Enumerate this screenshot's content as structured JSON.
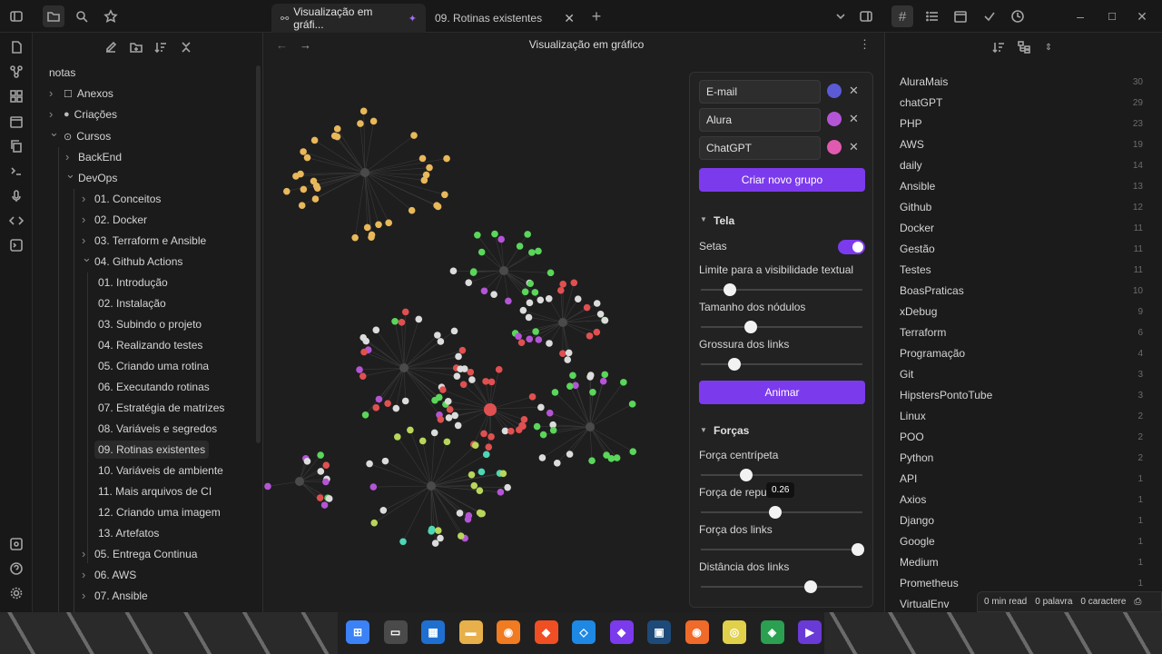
{
  "tabs": [
    {
      "label": "Visualização em gráfi..."
    },
    {
      "label": "09. Rotinas existentes"
    }
  ],
  "view_title": "Visualização em gráfico",
  "sidebar": {
    "root": "notas",
    "items": [
      {
        "label": "Anexos"
      },
      {
        "label": "Criações"
      },
      {
        "label": "Cursos"
      },
      {
        "label": "BackEnd"
      },
      {
        "label": "DevOps"
      },
      {
        "label": "01. Conceitos"
      },
      {
        "label": "02. Docker"
      },
      {
        "label": "03. Terraform e Ansible"
      },
      {
        "label": "04. Github Actions"
      },
      {
        "label": "01. Introdução"
      },
      {
        "label": "02. Instalação"
      },
      {
        "label": "03. Subindo o projeto"
      },
      {
        "label": "04. Realizando testes"
      },
      {
        "label": "05. Criando uma rotina"
      },
      {
        "label": "06. Executando rotinas"
      },
      {
        "label": "07. Estratégia de matrizes"
      },
      {
        "label": "08. Variáveis e segredos"
      },
      {
        "label": "09. Rotinas existentes"
      },
      {
        "label": "10. Variáveis de ambiente"
      },
      {
        "label": "11. Mais arquivos de CI"
      },
      {
        "label": "12. Criando uma imagem"
      },
      {
        "label": "13. Artefatos"
      },
      {
        "label": "05. Entrega Continua"
      },
      {
        "label": "06. AWS"
      },
      {
        "label": "07. Ansible"
      }
    ]
  },
  "graph_panel": {
    "groups": [
      {
        "query": "E-mail",
        "color": "#5b5bd6"
      },
      {
        "query": "Alura",
        "color": "#b455d6"
      },
      {
        "query": "ChatGPT",
        "color": "#e05ab0"
      }
    ],
    "new_group_label": "Criar novo grupo",
    "display_section": "Tela",
    "arrows_label": "Setas",
    "arrows_on": true,
    "text_fade_label": "Limite para a visibilidade textual",
    "text_fade_value": 0.18,
    "node_size_label": "Tamanho dos nódulos",
    "node_size_value": 0.31,
    "link_thickness_label": "Grossura dos links",
    "link_thickness_value": 0.21,
    "animate_label": "Animar",
    "forces_section": "Forças",
    "center_force_label": "Força centrípeta",
    "center_force_value": 0.28,
    "repel_force_label": "Força de repu",
    "repel_force_value": 0.46,
    "repel_tooltip": "0.26",
    "link_force_label": "Força dos links",
    "link_force_value": 0.97,
    "link_distance_label": "Distância dos links",
    "link_distance_value": 0.68
  },
  "tags": [
    {
      "name": "AluraMais",
      "count": "30"
    },
    {
      "name": "chatGPT",
      "count": "29"
    },
    {
      "name": "PHP",
      "count": "23"
    },
    {
      "name": "AWS",
      "count": "19"
    },
    {
      "name": "daily",
      "count": "14"
    },
    {
      "name": "Ansible",
      "count": "13"
    },
    {
      "name": "Github",
      "count": "12"
    },
    {
      "name": "Docker",
      "count": "11"
    },
    {
      "name": "Gestão",
      "count": "11"
    },
    {
      "name": "Testes",
      "count": "11"
    },
    {
      "name": "BoasPraticas",
      "count": "10"
    },
    {
      "name": "xDebug",
      "count": "9"
    },
    {
      "name": "Terraform",
      "count": "6"
    },
    {
      "name": "Programação",
      "count": "4"
    },
    {
      "name": "Git",
      "count": "3"
    },
    {
      "name": "HipstersPontoTube",
      "count": "3"
    },
    {
      "name": "Linux",
      "count": "2"
    },
    {
      "name": "POO",
      "count": "2"
    },
    {
      "name": "Python",
      "count": "2"
    },
    {
      "name": "API",
      "count": "1"
    },
    {
      "name": "Axios",
      "count": "1"
    },
    {
      "name": "Django",
      "count": "1"
    },
    {
      "name": "Google",
      "count": "1"
    },
    {
      "name": "Medium",
      "count": "1"
    },
    {
      "name": "Prometheus",
      "count": "1"
    },
    {
      "name": "VirtualEnv",
      "count": ""
    }
  ],
  "status": {
    "read": "0 min read",
    "words": "0 palavra",
    "chars": "0 caractere"
  },
  "graph_colors": {
    "yellow": "#e8b85a",
    "green": "#5ad65a",
    "red": "#e05050",
    "purple": "#b455d6",
    "blue": "#5b5bd6",
    "white": "#dcdcdc",
    "grey": "#4a4a4a",
    "lime": "#b8d65a",
    "teal": "#4fd6b4"
  },
  "taskbar_icons": [
    "windows-icon",
    "files-icon",
    "store-icon",
    "folder-icon",
    "mail-icon",
    "brave-icon",
    "vscode-icon",
    "obsidian-icon",
    "terminal-icon",
    "postman-icon",
    "tableplus-icon",
    "git-icon",
    "media-icon"
  ]
}
